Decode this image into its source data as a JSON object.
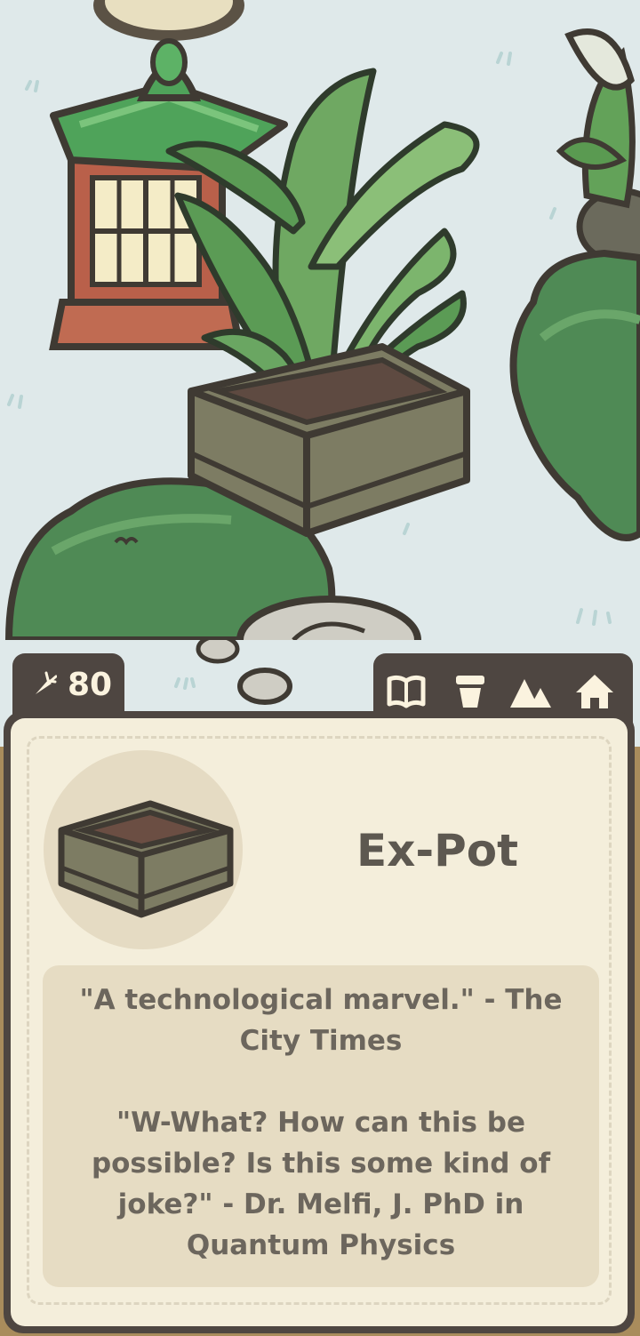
{
  "hud": {
    "carrot_icon": "carrot-icon",
    "carrot_count": "80"
  },
  "nav": {
    "items": [
      {
        "icon": "book-icon"
      },
      {
        "icon": "pot-icon"
      },
      {
        "icon": "mountain-icon"
      },
      {
        "icon": "home-icon"
      }
    ]
  },
  "item": {
    "icon": "ex-pot-icon",
    "name": "Ex-Pot",
    "quote_1": "\"A technological marvel.\" - The City Times",
    "quote_2": "\"W-What? How can this be possible? Is this some kind of joke?\" - Dr. Melfi, J. PhD in Quantum Physics"
  },
  "colors": {
    "panel_dark": "#4e4641",
    "panel_cream": "#f4eedb",
    "desc_bg": "#e6dcc3",
    "text": "#6c665d",
    "sky": "#dfe9ea",
    "bush": "#4f8a55",
    "leaf": "#5b9b55",
    "pot": "#7d7c63",
    "lantern_roof": "#4fa35a",
    "lantern_wood": "#b9604a"
  }
}
